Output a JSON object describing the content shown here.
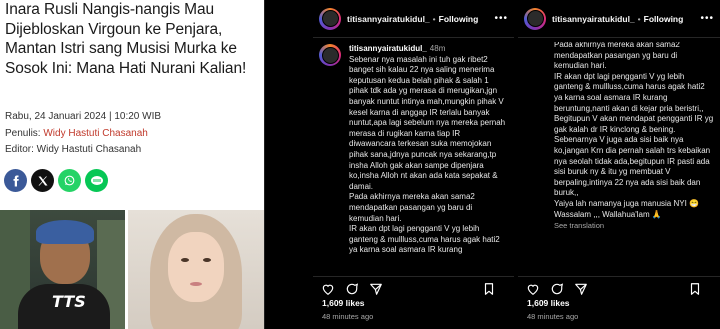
{
  "article": {
    "title": "Inara Rusli Nangis-nangis Mau Dijebloskan Virgoun ke Penjara, Mantan Istri sang Musisi Murka ke Sosok Ini: Mana Hati Nurani Kalian!",
    "date": "Rabu, 24 Januari 2024 | 10:20 WIB",
    "writer_label": "Penulis:",
    "writer_name": "Widy Hastuti Chasanah",
    "editor": "Editor: Widy Hastuti Chasanah",
    "share_icons": [
      "facebook-icon",
      "x-icon",
      "whatsapp-icon",
      "line-icon"
    ],
    "shirt_text": "TTS"
  },
  "instagram": [
    {
      "username": "titisannyairatukidul_",
      "dot": "•",
      "follow_label": "Following",
      "more": "•••",
      "comment_user": "titisannyairatukidul_",
      "comment_time": "48m",
      "comment_paragraphs": [
        "Sebenar nya masalah ini tuh gak ribet2 banget sih kalau 22 nya saling menerima keputusan kedua belah pihak & salah 1 pihak tdk ada yg merasa di merugikan,jgn banyak nuntut intinya mah,mungkin pihak V kesel karna di anggap IR terlalu banyak nuntut,apa lagi sebelum nya mereka pernah merasa di rugikan karna tiap IR diwawancara terkesan suka memojokan pihak sana,jdnya puncak nya sekarang,tp insha Alloh gak akan sampe dipenjara ko,insha Alloh nt akan ada kata sepakat & damai.",
        "Pada akhirnya mereka akan sama2 mendapatkan pasangan yg baru di kemudian hari.",
        "IR akan dpt lagi pengganti V yg lebih ganteng & mullluss,cuma harus agak hati2 ya karna soal asmara IR kurang"
      ],
      "likes": "1,609 likes",
      "time": "48 minutes ago"
    },
    {
      "username": "titisannyairatukidul_",
      "dot": "•",
      "follow_label": "Following",
      "more": "•••",
      "comment_paragraphs": [
        "Pada akhirnya mereka akan sama2 mendapatkan pasangan yg baru di kemudian hari.",
        "IR akan dpt lagi pengganti V yg lebih ganteng & mullluss,cuma harus agak hati2 ya karna soal asmara IR kurang beruntung,nanti akan di kejar pria beristri,,",
        "Begitupun V akan mendapat pengganti IR yg gak kalah dr IR kinclong & bening.",
        "Sebenarnya V juga ada sisi baik nya ko,jangan Krn dia pernah salah trs kebaikan nya seolah tidak ada,begitupun IR pasti ada sisi buruk ny & itu yg membuat V berpaling,intinya 22 nya ada sisi baik dan buruk,,",
        "Yaiya lah namanya juga manusia NYI 😁",
        "Wassalam ,,, Wallahua'lam 🙏"
      ],
      "see_translation": "See translation",
      "likes": "1,609 likes",
      "time": "48 minutes ago"
    }
  ],
  "colors": {
    "background": "#000000",
    "article_bg": "#ffffff",
    "writer_link": "#c0392b",
    "muted_text": "#a8a8a8"
  }
}
